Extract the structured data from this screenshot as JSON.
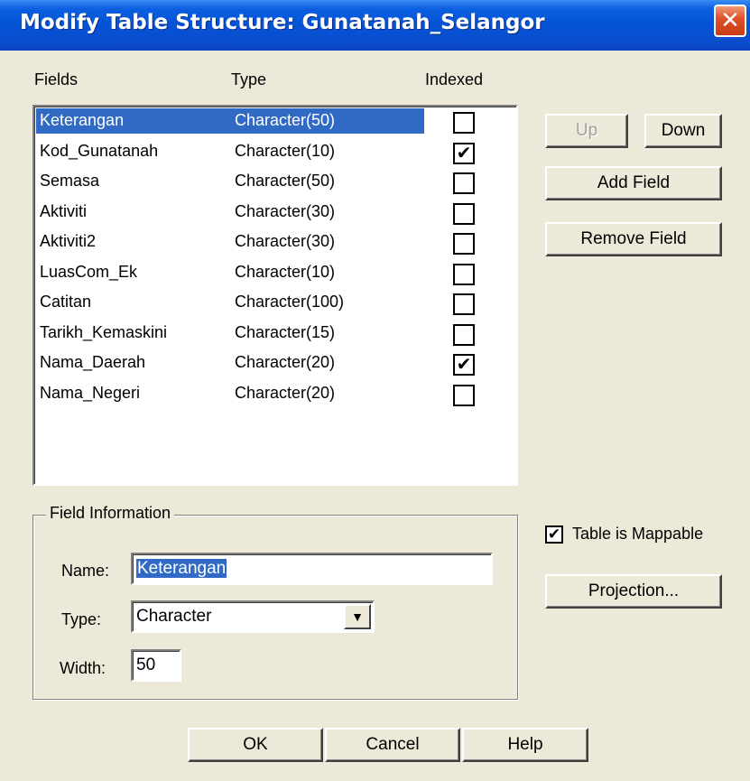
{
  "window": {
    "title": "Modify Table Structure: Gunatanah_Selangor",
    "close_glyph": "✕"
  },
  "columns": {
    "fields": "Fields",
    "type": "Type",
    "indexed": "Indexed"
  },
  "fields": [
    {
      "name": "Keterangan",
      "type": "Character(50)",
      "indexed": false,
      "selected": true
    },
    {
      "name": "Kod_Gunatanah",
      "type": "Character(10)",
      "indexed": true,
      "selected": false
    },
    {
      "name": "Semasa",
      "type": "Character(50)",
      "indexed": false,
      "selected": false
    },
    {
      "name": "Aktiviti",
      "type": "Character(30)",
      "indexed": false,
      "selected": false
    },
    {
      "name": "Aktiviti2",
      "type": "Character(30)",
      "indexed": false,
      "selected": false
    },
    {
      "name": "LuasCom_Ek",
      "type": "Character(10)",
      "indexed": false,
      "selected": false
    },
    {
      "name": "Catitan",
      "type": "Character(100)",
      "indexed": false,
      "selected": false
    },
    {
      "name": "Tarikh_Kemaskini",
      "type": "Character(15)",
      "indexed": false,
      "selected": false
    },
    {
      "name": "Nama_Daerah",
      "type": "Character(20)",
      "indexed": true,
      "selected": false
    },
    {
      "name": "Nama_Negeri",
      "type": "Character(20)",
      "indexed": false,
      "selected": false
    }
  ],
  "buttons": {
    "up": "Up",
    "down": "Down",
    "add_field": "Add Field",
    "remove_field": "Remove Field",
    "projection": "Projection...",
    "ok": "OK",
    "cancel": "Cancel",
    "help": "Help"
  },
  "field_info": {
    "group_label": "Field Information",
    "name_label": "Name:",
    "name_value": "Keterangan",
    "type_label": "Type:",
    "type_value": "Character",
    "width_label": "Width:",
    "width_value": "50"
  },
  "mappable": {
    "label": "Table is Mappable",
    "checked": true
  },
  "icons": {
    "checkmark": "✔",
    "dropdown": "▼"
  },
  "colors": {
    "selection": "#316ac5",
    "titlebar": "#0552d6",
    "dialog_bg": "#ece9d8"
  }
}
